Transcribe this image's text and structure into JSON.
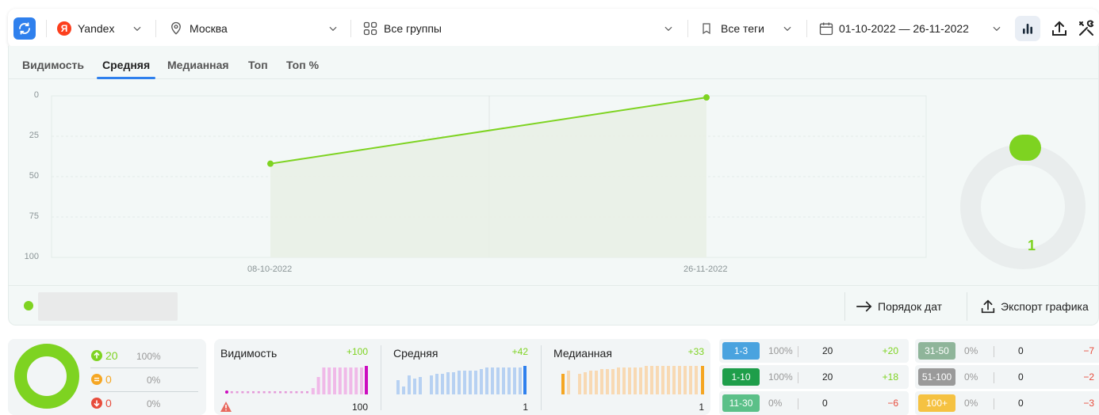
{
  "toolbar": {
    "engine": "Yandex",
    "engine_badge": "Я",
    "region": "Москва",
    "groups": "Все группы",
    "tags": "Все теги",
    "date_range": "01-10-2022 — 26-11-2022"
  },
  "tabs": [
    {
      "label": "Видимость",
      "active": false
    },
    {
      "label": "Средняя",
      "active": true
    },
    {
      "label": "Медианная",
      "active": false
    },
    {
      "label": "Топ",
      "active": false
    },
    {
      "label": "Топ %",
      "active": false
    }
  ],
  "chart_data": {
    "type": "line",
    "x": [
      "08-10-2022",
      "26-11-2022"
    ],
    "series": [
      {
        "values": [
          42,
          1
        ],
        "color": "#7ed321"
      }
    ],
    "yticks": [
      "0",
      "25",
      "50",
      "75",
      "100"
    ],
    "ylim": [
      0,
      100
    ],
    "y_inverted": true,
    "grid": true
  },
  "donut": {
    "label": "1",
    "color": "#7ed321"
  },
  "footer": {
    "date_order": "Порядок дат",
    "export_chart": "Экспорт графика"
  },
  "summary": {
    "up": {
      "count": "20",
      "pct": "100%"
    },
    "same": {
      "count": "0",
      "pct": "0%"
    },
    "down": {
      "count": "0",
      "pct": "0%"
    }
  },
  "metrics": [
    {
      "title": "Видимость",
      "delta": "+100",
      "value": "100",
      "color": "#e59ad9",
      "accent": "#cc0cbf"
    },
    {
      "title": "Средняя",
      "delta": "+42",
      "value": "1",
      "color": "#a8c8ef",
      "accent": "#2f80ed"
    },
    {
      "title": "Медианная",
      "delta": "+33",
      "value": "1",
      "color": "#f6d5ad",
      "accent": "#f5a623"
    }
  ],
  "ranges_left": [
    {
      "label": "1-3",
      "pct": "100%",
      "count": "20",
      "delta": "+20",
      "color": "#4aa3df",
      "delta_color": "#7ed321"
    },
    {
      "label": "1-10",
      "pct": "100%",
      "count": "20",
      "delta": "+18",
      "color": "#1e9e4a",
      "delta_color": "#7ed321"
    },
    {
      "label": "11-30",
      "pct": "0%",
      "count": "0",
      "delta": "−6",
      "color": "#5bc088",
      "delta_color": "#e74c3c"
    }
  ],
  "ranges_right": [
    {
      "label": "31-50",
      "pct": "0%",
      "count": "0",
      "delta": "−7",
      "color": "#8fb59a",
      "delta_color": "#e74c3c"
    },
    {
      "label": "51-100",
      "pct": "0%",
      "count": "0",
      "delta": "−2",
      "color": "#9a9a9a",
      "delta_color": "#e74c3c"
    },
    {
      "label": "100+",
      "pct": "0%",
      "count": "0",
      "delta": "−3",
      "color": "#f5c242",
      "delta_color": "#e74c3c"
    }
  ]
}
